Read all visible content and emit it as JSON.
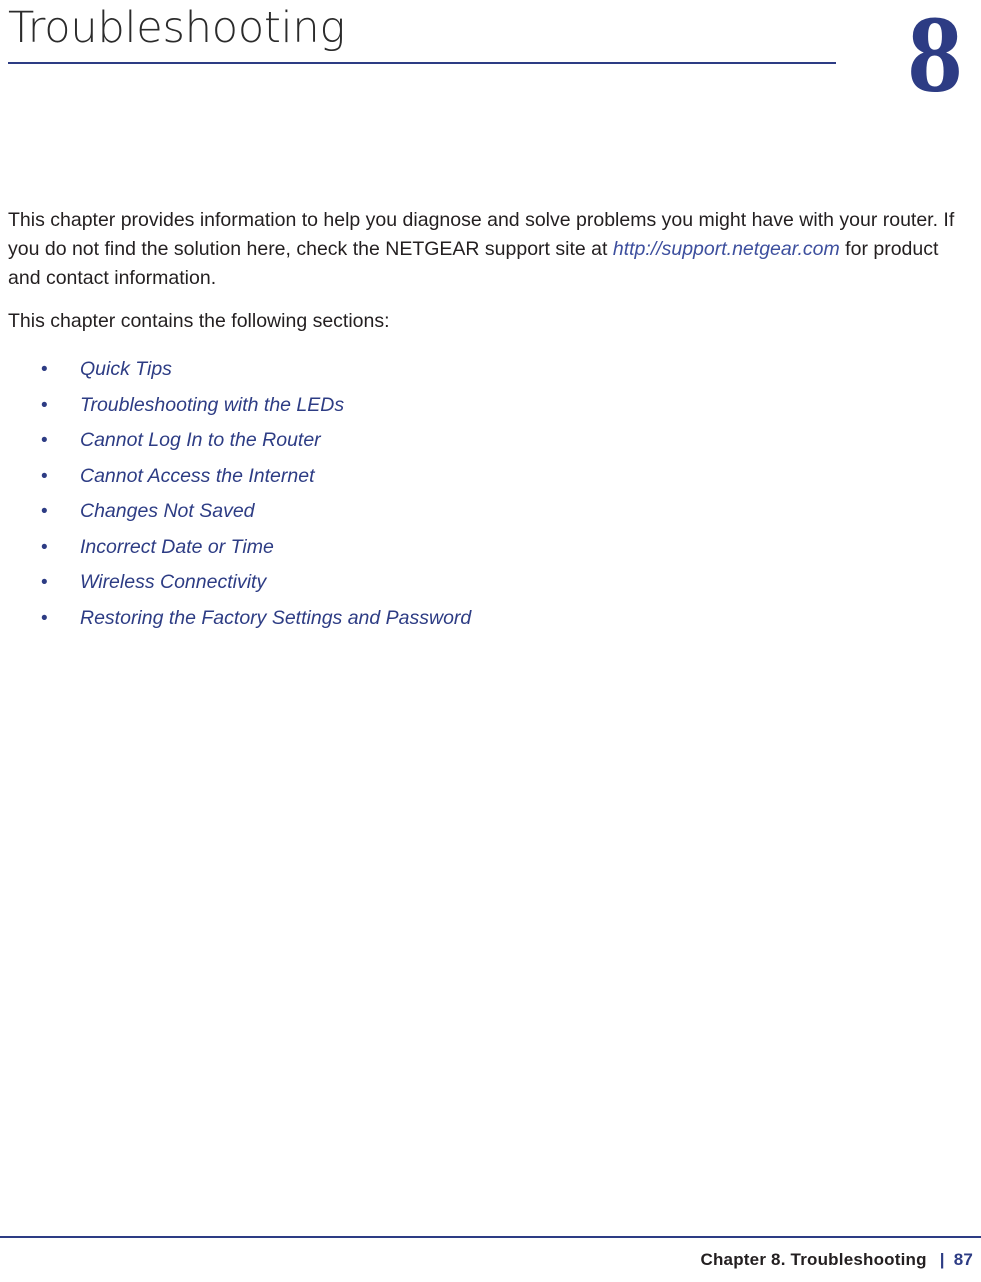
{
  "header": {
    "title": "Troubleshooting",
    "chapter_number": "8",
    "accent_color": "#2d3c84"
  },
  "body": {
    "intro_part1": "This chapter provides information to help you diagnose and solve problems you might have with your router. If you do not find the solution here, check the NETGEAR support site at ",
    "intro_link": "http://support.netgear.com",
    "intro_part2": " for product and contact information.",
    "sections_lead": "This chapter contains the following sections:"
  },
  "toc": {
    "bullet_glyph": "•",
    "items": [
      {
        "label": "Quick Tips"
      },
      {
        "label": "Troubleshooting with the LEDs"
      },
      {
        "label": "Cannot Log In to the Router"
      },
      {
        "label": "Cannot Access the Internet"
      },
      {
        "label": "Changes Not Saved"
      },
      {
        "label": "Incorrect Date or Time"
      },
      {
        "label": "Wireless Connectivity"
      },
      {
        "label": "Restoring the Factory Settings and Password"
      }
    ]
  },
  "footer": {
    "chapter_label": "Chapter 8.  Troubleshooting",
    "separator": "|",
    "page_number": "87"
  }
}
